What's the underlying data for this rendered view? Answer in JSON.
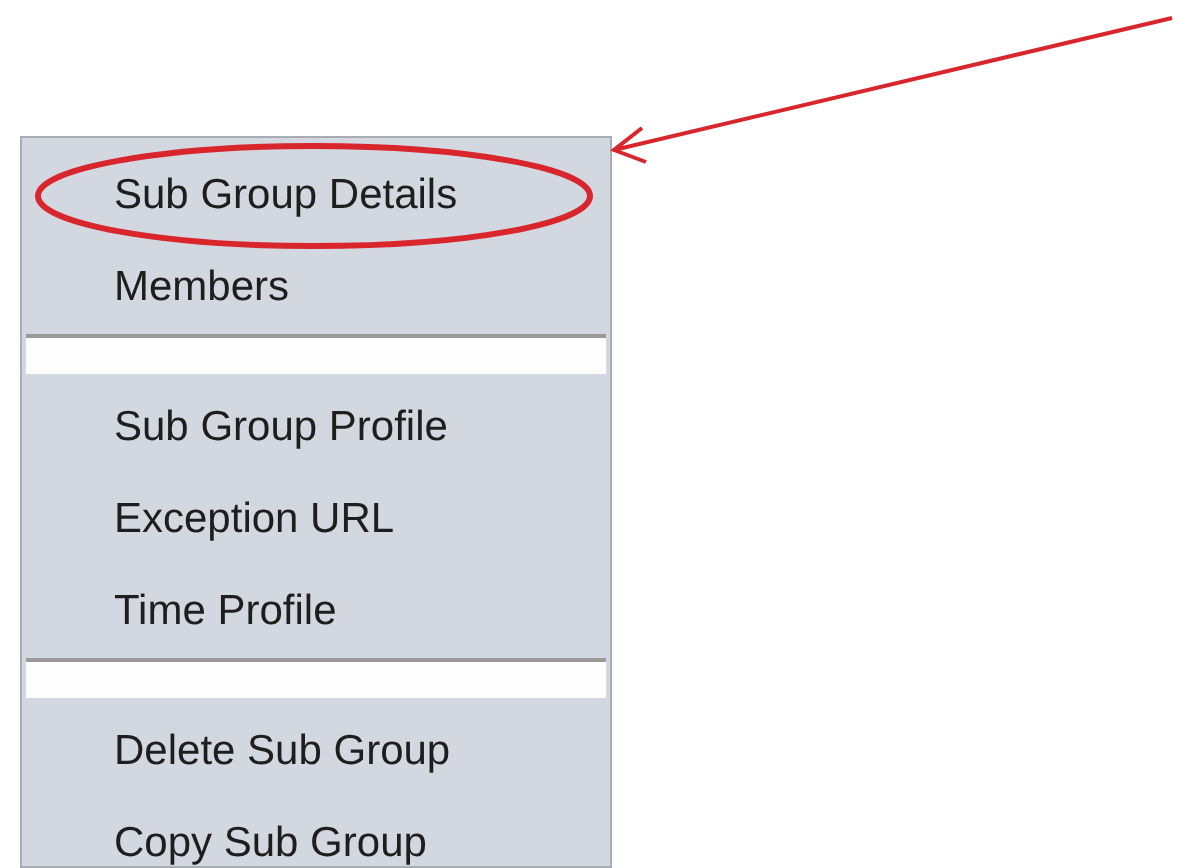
{
  "menu": {
    "items": [
      {
        "kind": "item",
        "label": "Sub Group Details",
        "circled": true
      },
      {
        "kind": "item",
        "label": "Members",
        "circled": false
      },
      {
        "kind": "separator"
      },
      {
        "kind": "item",
        "label": "Sub Group Profile",
        "circled": false
      },
      {
        "kind": "item",
        "label": "Exception URL",
        "circled": false
      },
      {
        "kind": "item",
        "label": "Time Profile",
        "circled": false
      },
      {
        "kind": "separator"
      },
      {
        "kind": "item",
        "label": "Delete Sub Group",
        "circled": false
      },
      {
        "kind": "item",
        "label": "Copy Sub Group",
        "circled": false
      }
    ]
  },
  "annotation": {
    "arrow": true
  }
}
